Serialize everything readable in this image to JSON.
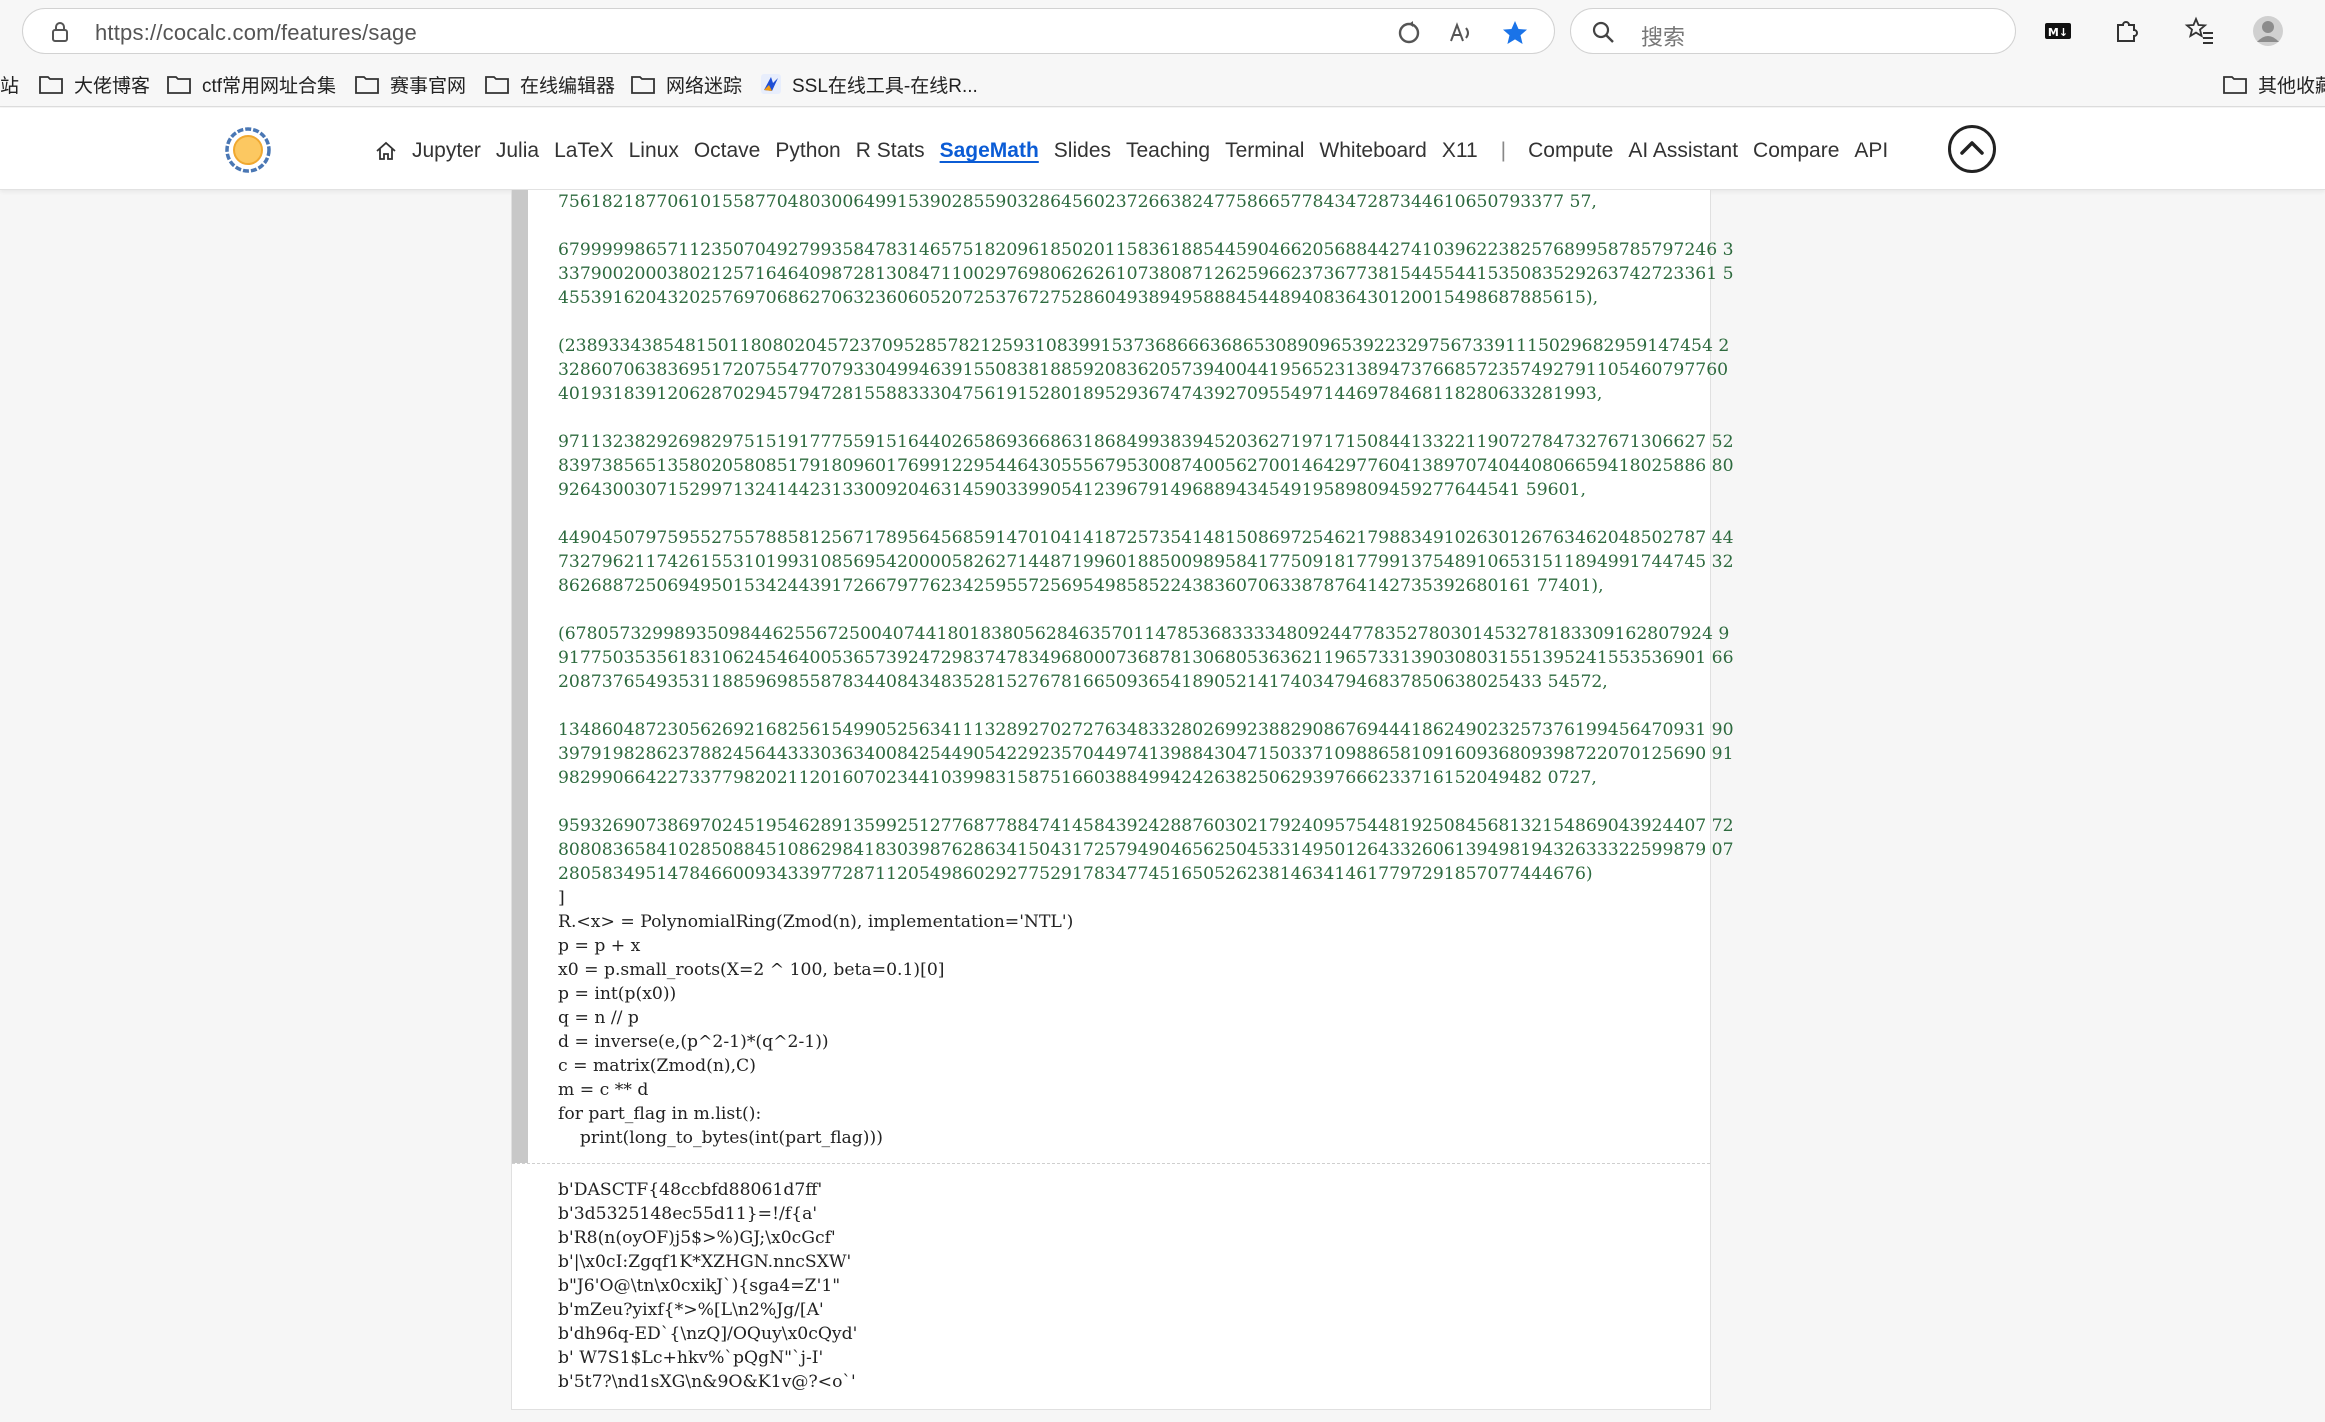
{
  "browser": {
    "url": "https://cocalc.com/features/sage",
    "search_placeholder": "搜索"
  },
  "bookmarks": [
    {
      "label": "站",
      "icon": "folder-icon"
    },
    {
      "label": "大佬博客",
      "icon": "folder-icon"
    },
    {
      "label": "ctf常用网址合集",
      "icon": "folder-icon"
    },
    {
      "label": "赛事官网",
      "icon": "folder-icon"
    },
    {
      "label": "在线编辑器",
      "icon": "folder-icon"
    },
    {
      "label": "网络迷踪",
      "icon": "folder-icon"
    },
    {
      "label": "SSL在线工具-在线R...",
      "icon": "ssl-site-icon"
    },
    {
      "label": "其他收藏",
      "icon": "folder-icon"
    }
  ],
  "nav": {
    "items": [
      "Jupyter",
      "Julia",
      "LaTeX",
      "Linux",
      "Octave",
      "Python",
      "R Stats",
      "SageMath",
      "Slides",
      "Teaching",
      "Terminal",
      "Whiteboard",
      "X11"
    ],
    "separator": "|",
    "items2": [
      "Compute",
      "AI Assistant",
      "Compare",
      "API"
    ],
    "active": "SageMath"
  },
  "code": {
    "paras": [
      "75618218770610155877048030064991539028559032864560237266382477586657784347287344610650793377 57,",
      "6799999865711235070492799358478314657518209618502011583618854459046620568844274103962238257689958785797246 3\n3379002000380212571646409872813084711002976980626261073808712625966237367738154455441535083529263742723361 5\n4553916204320257697068627063236060520725376727528604938949588845448940836430120015498687885615),",
      "(238933438548150118080204572370952857821259310839915373686663686530890965392232975673391115029682959147454 2\n32860706383695172075547707933049946391550838188592083620573940044195652313894737668572357492791105460797760\n40193183912062870294579472815588333047561915280189529367474392709554971446978468118280633281993,",
      "971132382926982975151917775591516440265869366863186849938394520362719717150844133221190727847327671306627 52\n839738565135802058085179180960176991229544643055567953008740056270014642977604138970740440806659418025886 80\n9264300307152997132414423133009204631459033990541239679149688943454919589809459277644541 59601,",
      "449045079759552755788581256717895645685914701041418725735414815086972546217988349102630126763462048502787 44\n732796211742615531019931085695420000582627144871996018850098958417750918177991375489106531511894991744745 32\n86268872506949501534244391726679776234259557256954985852243836070633878764142735392680161 77401),",
      "(678057329989350984462556725004074418018380562846357011478536833334809244778352780301453278183309162807924 9\n917750353561831062454640053657392472983747834968000736878130680536362119657331390308031551395241553536901 66\n208737654935311885969855878344084348352815276781665093654189052141740347946837850638025433 54572,",
      "134860487230562692168256154990525634111328927027276348332802699238829086769444186249023257376199456470931 90\n397919828623788245644333036340084254490542292357044974139884304715033710988658109160936809398722070125690 91\n982990664227337798202112016070234410399831587516603884994242638250629397666233716152049482 0727,",
      "959326907386970245195462891359925127768778847414584392428876030217924095754481925084568132154869043924407 72\n808083658410285088451086298418303987628634150431725794904656250453314950126433260613949819432633322599879 07\n2805834951478466009343397728711205498602927752917834774516505262381463414617797291857077444676)",
      "]"
    ],
    "lines": [
      "R.<x> = PolynomialRing(Zmod(n), implementation='NTL')",
      "p = p + x",
      "x0 = p.small_roots(X=2 ^ 100, beta=0.1)[0]",
      "p = int(p(x0))",
      "q = n // p",
      "d = inverse(e,(p^2-1)*(q^2-1))",
      "c = matrix(Zmod(n),C)",
      "m = c ** d",
      "for part_flag in m.list():",
      "    print(long_to_bytes(int(part_flag)))"
    ]
  },
  "output": [
    "b'DASCTF{48ccbfd88061d7ff'",
    "b'3d5325148ec55d11}=!/f{a'",
    "b'R8(n(oyOF)j5$>%)GJ;\\x0cGcf'",
    "b'|\\x0cI:Zgqf1K*XZHGN.nncSXW'",
    "b\"J6'O@\\tn\\x0cxikJ`){sga4=Z'1\"",
    "b'mZeu?yixf{*>%[L\\n2%Jg/[A'",
    "b'dh96q-ED`{\\nzQ]/OQuy\\x0cQyd'",
    "b' W7S1$Lc+hkv%`pQgN\"`j-I'",
    "b'5t7?\\nd1sXG\\n&9O&K1v@?<o`'"
  ]
}
